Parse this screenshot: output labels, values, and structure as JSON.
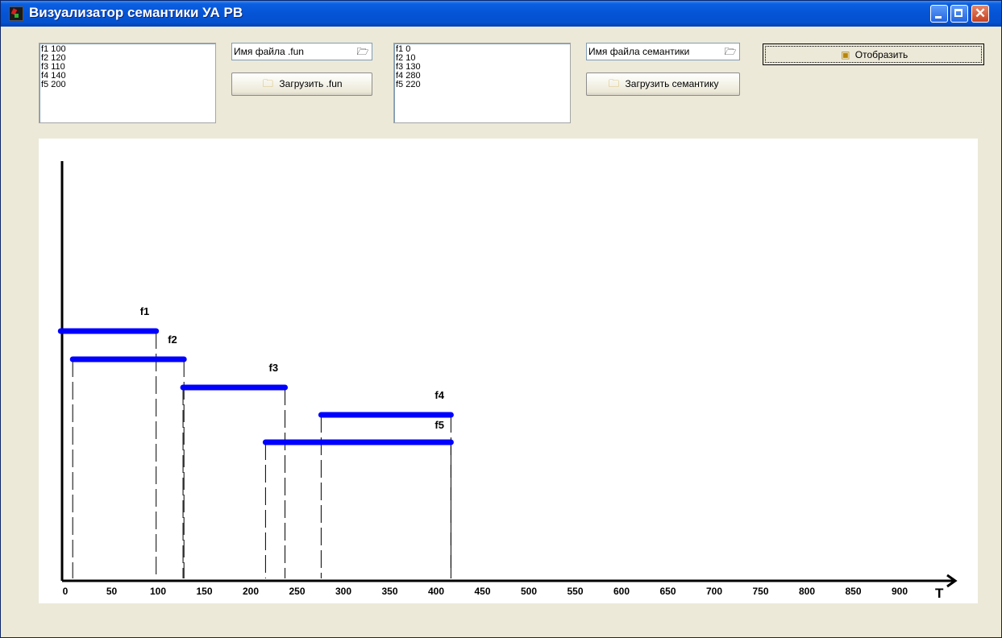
{
  "window": {
    "title": "Визуализатор семантики УА РВ",
    "controls": {
      "minimize": "minimize-icon",
      "maximize": "maximize-icon",
      "close": "close-icon"
    }
  },
  "fun_list": {
    "items": [
      "f1 100",
      "f2 120",
      "f3 110",
      "f4 140",
      "f5 200"
    ]
  },
  "fun_file": {
    "value": "Имя файла .fun",
    "icon": "folder-open-icon"
  },
  "load_fun_button": {
    "label": "Загрузить .fun",
    "icon": "folder-icon"
  },
  "sem_list": {
    "items": [
      "f1 0",
      "f2 10",
      "f3 130",
      "f4 280",
      "f5 220"
    ]
  },
  "sem_file": {
    "value": "Имя файла семантики",
    "icon": "folder-open-icon"
  },
  "load_sem_button": {
    "label": "Загрузить семантику",
    "icon": "folder-icon"
  },
  "show_button": {
    "label": "Отобразить",
    "icon": "display-icon"
  },
  "chart_data": {
    "type": "gantt",
    "x_label": "T",
    "x_ticks": [
      0,
      50,
      100,
      150,
      200,
      250,
      300,
      350,
      400,
      450,
      500,
      550,
      600,
      650,
      700,
      750,
      800,
      850,
      900
    ],
    "xlim": [
      0,
      960
    ],
    "bar_color": "#0000ff",
    "intervals": [
      {
        "name": "f1",
        "start": -5,
        "end": 98
      },
      {
        "name": "f2",
        "start": 8,
        "end": 128
      },
      {
        "name": "f3",
        "start": 127,
        "end": 237
      },
      {
        "name": "f4",
        "start": 276,
        "end": 416
      },
      {
        "name": "f5",
        "start": 216,
        "end": 416
      }
    ]
  }
}
